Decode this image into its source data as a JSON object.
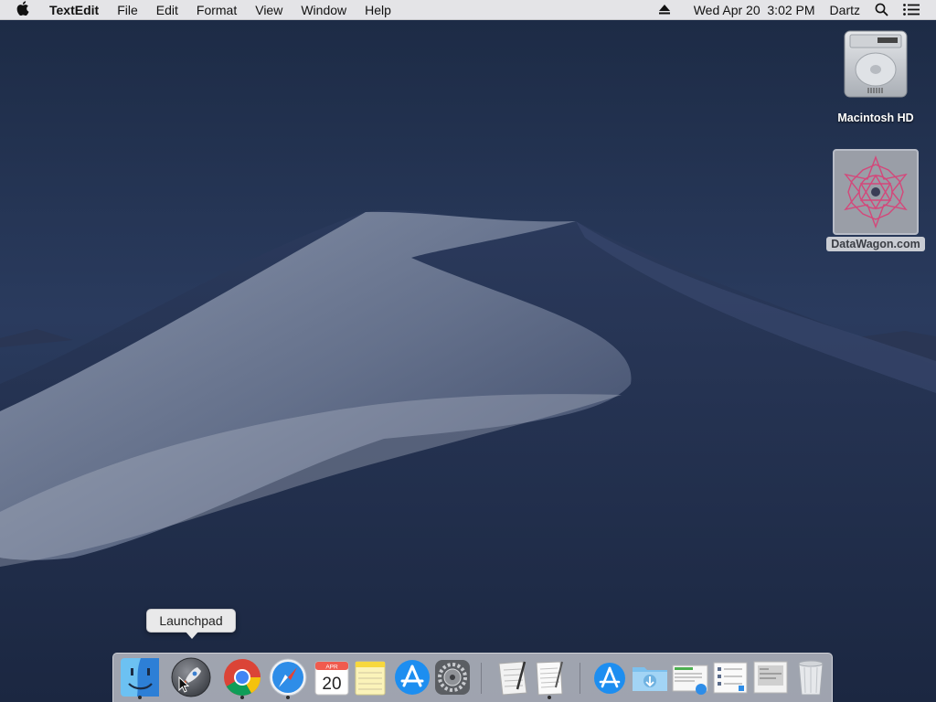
{
  "menubar": {
    "apple_icon": "apple-logo-icon",
    "app_name": "TextEdit",
    "menus": [
      "File",
      "Edit",
      "Format",
      "View",
      "Window",
      "Help"
    ],
    "eject_icon": "eject-icon",
    "datetime": "Wed Apr 20  3:02 PM",
    "user": "Dartz",
    "search_icon": "spotlight-search-icon",
    "notification_icon": "notification-center-icon"
  },
  "desktop": {
    "icons": [
      {
        "label": "Macintosh HD",
        "icon": "hard-drive-icon"
      },
      {
        "label": "DataWagon.com",
        "icon": "image-file-thumbnail"
      }
    ]
  },
  "tooltip": "Launchpad",
  "dock": {
    "items": [
      {
        "name": "Finder",
        "icon": "finder-icon",
        "running": true
      },
      {
        "name": "Launchpad",
        "icon": "launchpad-icon",
        "running": false
      },
      {
        "name": "Google Chrome",
        "icon": "chrome-icon",
        "running": true
      },
      {
        "name": "Safari",
        "icon": "safari-icon",
        "running": true
      },
      {
        "name": "Calendar",
        "icon": "calendar-icon",
        "running": false,
        "month": "APR",
        "day": "20"
      },
      {
        "name": "Notes",
        "icon": "notes-icon",
        "running": false
      },
      {
        "name": "App Store",
        "icon": "app-store-icon",
        "running": false
      },
      {
        "name": "System Preferences",
        "icon": "system-preferences-icon",
        "running": false
      },
      {
        "name": "Script Editor",
        "icon": "script-editor-icon",
        "running": false
      },
      {
        "name": "TextEdit",
        "icon": "textedit-icon",
        "running": true
      },
      {
        "name": "Applications",
        "icon": "applications-folder-icon",
        "running": false
      },
      {
        "name": "Downloads",
        "icon": "downloads-folder-icon",
        "running": false
      },
      {
        "name": "Document",
        "icon": "document-stack-icon",
        "running": false
      },
      {
        "name": "Document",
        "icon": "document-stack-icon-2",
        "running": false
      },
      {
        "name": "Document",
        "icon": "document-stack-icon-3",
        "running": false
      },
      {
        "name": "Trash",
        "icon": "trash-icon",
        "running": false
      }
    ]
  },
  "colors": {
    "menubar_bg": "#ecedee",
    "dock_bg": "#d2d4da",
    "wallpaper_sky": "#22314f"
  }
}
